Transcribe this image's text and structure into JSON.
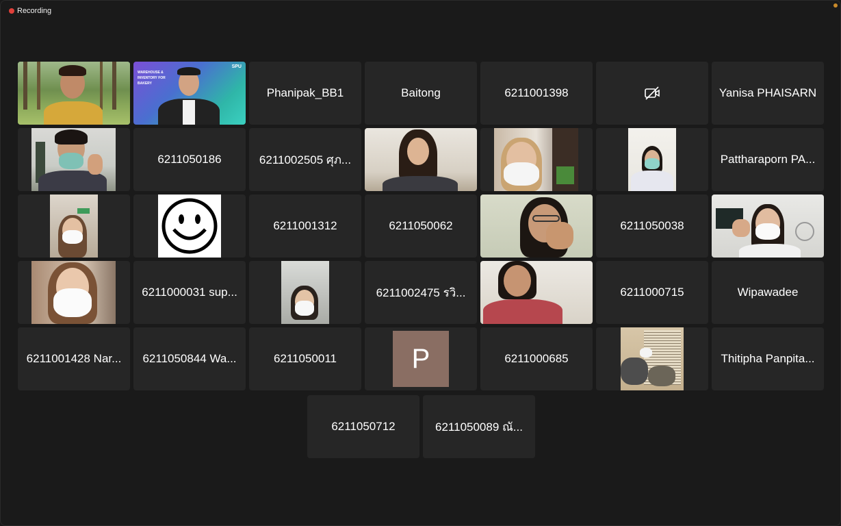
{
  "recording": {
    "label": "Recording"
  },
  "slide": {
    "title": "WAREHOUSE & INVENTORY FOR BAKERY",
    "logo": "SPU"
  },
  "avatar_letter": "P",
  "names": {
    "r1c3": "Phanipak_BB1",
    "r1c4": "Baitong",
    "r1c5": "6211001398",
    "r1c7": "Yanisa PHAISARN",
    "r2c2": "6211050186",
    "r2c3": "6211002505 ศุภ...",
    "r2c7": "Pattharaporn PA...",
    "r3c3": "6211001312",
    "r3c4": "6211050062",
    "r3c6": "6211050038",
    "r4c2": "6211000031 sup...",
    "r4c4": "6211002475 รวิ...",
    "r4c6": "6211000715",
    "r4c7": "Wipawadee",
    "r5c1": "6211001428 Nar...",
    "r5c2": "6211050844 Wa...",
    "r5c3": "6211050011",
    "r5c5": "6211000685",
    "r5c7": "Thitipha Panpita...",
    "r6c1": "6211050712",
    "r6c2": "6211050089 ณั..."
  }
}
